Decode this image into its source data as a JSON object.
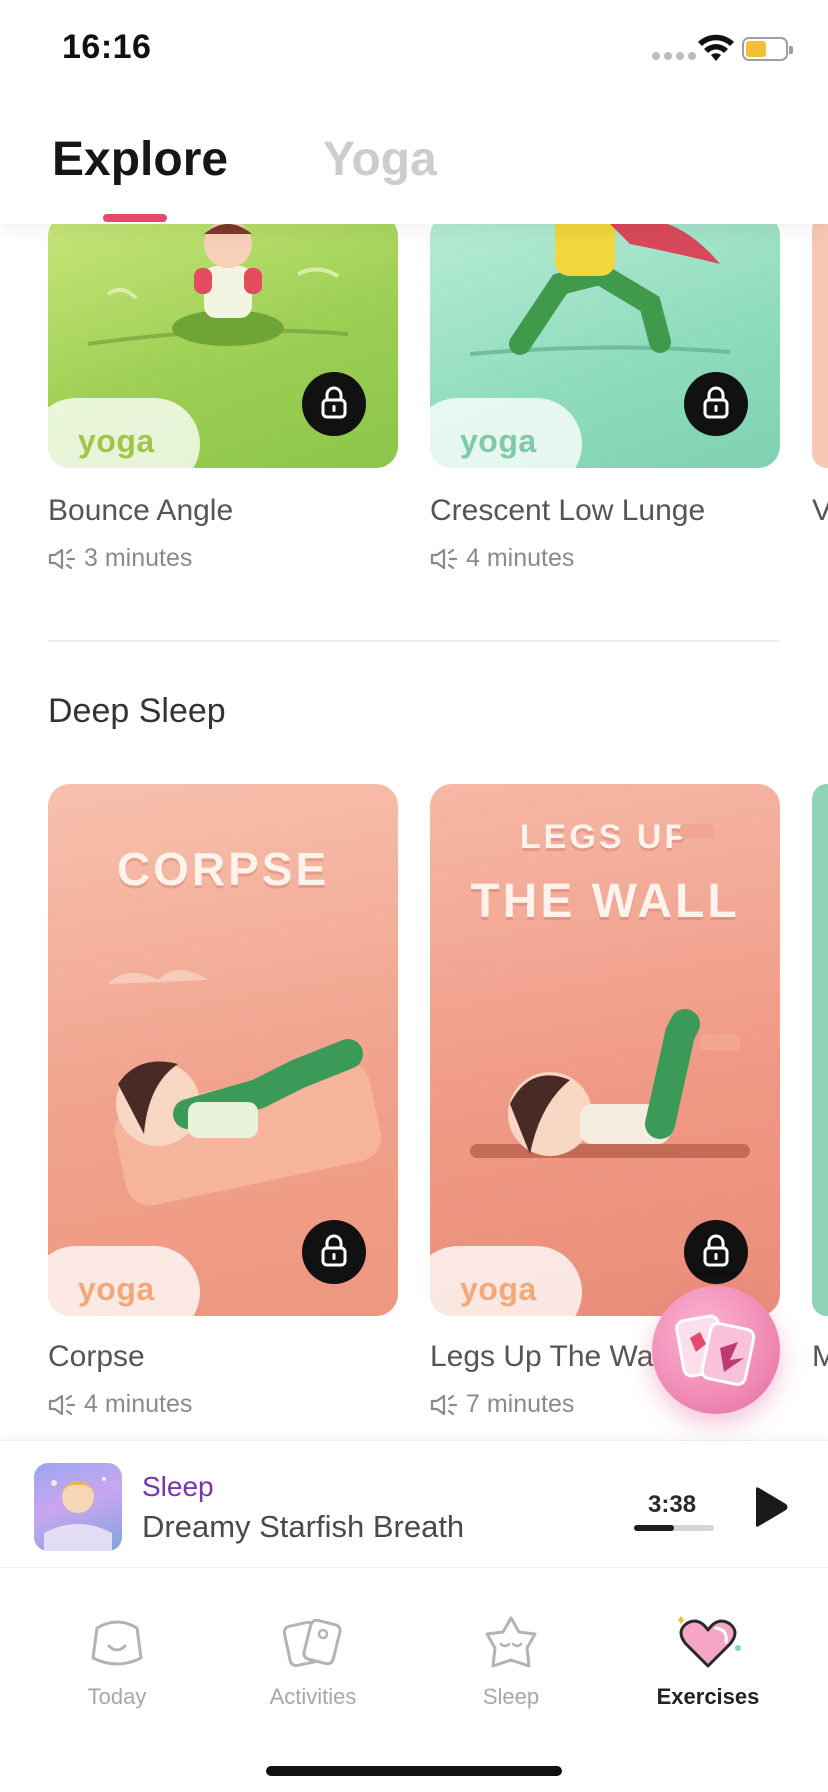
{
  "status_bar": {
    "time": "16:16"
  },
  "header": {
    "tabs": [
      {
        "label": "Explore",
        "active": true
      },
      {
        "label": "Yoga",
        "active": false
      }
    ]
  },
  "first_row": {
    "cards": [
      {
        "name": "Bounce Angle",
        "duration": "3 minutes",
        "tag": "yoga",
        "locked": true
      },
      {
        "name": "Crescent Low Lunge",
        "duration": "4 minutes",
        "tag": "yoga",
        "locked": true
      },
      {
        "name": "V",
        "duration": "",
        "tag": "",
        "locked": false
      }
    ]
  },
  "deep_sleep": {
    "title": "Deep Sleep",
    "cards": [
      {
        "name": "Corpse",
        "duration": "4 minutes",
        "tag": "yoga",
        "art_title": "CORPSE",
        "locked": true
      },
      {
        "name": "Legs Up The Wa",
        "duration": "7 minutes",
        "tag": "yoga",
        "art_title_1": "LEGS UP",
        "art_title_2": "THE WALL",
        "locked": true
      },
      {
        "name": "M",
        "duration": "",
        "tag": "",
        "locked": false
      }
    ]
  },
  "player": {
    "category": "Sleep",
    "title": "Dreamy Starfish Breath",
    "time": "3:38",
    "progress": 0.5
  },
  "bottom_nav": {
    "items": [
      {
        "label": "Today",
        "icon": "face-icon",
        "active": false
      },
      {
        "label": "Activities",
        "icon": "cards-icon",
        "active": false
      },
      {
        "label": "Sleep",
        "icon": "star-icon",
        "active": false
      },
      {
        "label": "Exercises",
        "icon": "heart-icon",
        "active": true
      }
    ]
  },
  "colors": {
    "accent": "#e34b6a",
    "player_category": "#7a34b0",
    "fab": "#f08ab5"
  }
}
